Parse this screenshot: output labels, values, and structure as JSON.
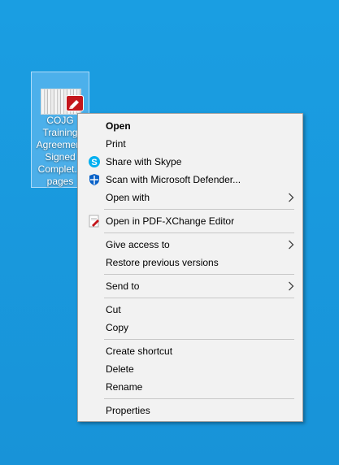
{
  "desktop_icon": {
    "label_lines": [
      "COJG",
      "Training",
      "Agreement",
      "Signed",
      "Complet...",
      "pages"
    ]
  },
  "menu": {
    "open": "Open",
    "print": "Print",
    "share_skype": "Share with Skype",
    "scan_defender": "Scan with Microsoft Defender...",
    "open_with": "Open with",
    "open_pdfxchange": "Open in PDF-XChange Editor",
    "give_access": "Give access to",
    "restore_versions": "Restore previous versions",
    "send_to": "Send to",
    "cut": "Cut",
    "copy": "Copy",
    "create_shortcut": "Create shortcut",
    "delete": "Delete",
    "rename": "Rename",
    "properties": "Properties"
  },
  "colors": {
    "desktop": "#1a96dc",
    "menu_bg": "#f2f2f2",
    "skype": "#00aff0",
    "defender": "#0a62c8",
    "pdf_red": "#c4161c"
  }
}
